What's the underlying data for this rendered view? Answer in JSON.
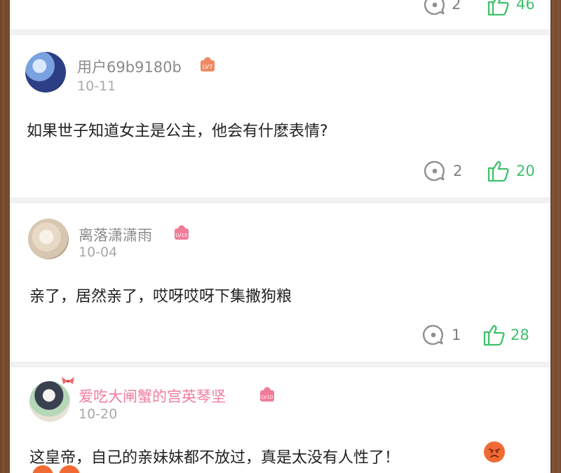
{
  "comments": [
    {
      "user": "",
      "date": "",
      "text": "",
      "replies": "2",
      "likes": "46"
    },
    {
      "user": "用户69b9180b",
      "level": "LV7",
      "date": "10-11",
      "text": "如果世子知道女主是公主，他会有什麽表情?",
      "replies": "2",
      "likes": "20"
    },
    {
      "user": "离落潇潇雨",
      "level": "LV10",
      "date": "10-04",
      "text": "亲了，居然亲了，哎呀哎呀下集撒狗粮",
      "replies": "1",
      "likes": "28"
    },
    {
      "user": "爱吃大闸蟹的宫英琴坚",
      "level": "LV10",
      "date": "10-20",
      "text": "这皇帝，自己的亲妹妹都不放过，真是太没有人性了！"
    }
  ],
  "icons": {
    "reply": "reply-bubble-icon",
    "like": "thumbs-up-icon",
    "level": "level-badge-icon",
    "emoji": "angry-face-icon"
  },
  "colors": {
    "accent_green": "#3cc16b",
    "username_gray": "#8a8a8a",
    "username_pink": "#f07c9a",
    "level_orange": "#f08a63",
    "level_pink": "#f07c9a",
    "emoji_orange": "#f26a33",
    "frame_brown": "#8d5b38"
  }
}
